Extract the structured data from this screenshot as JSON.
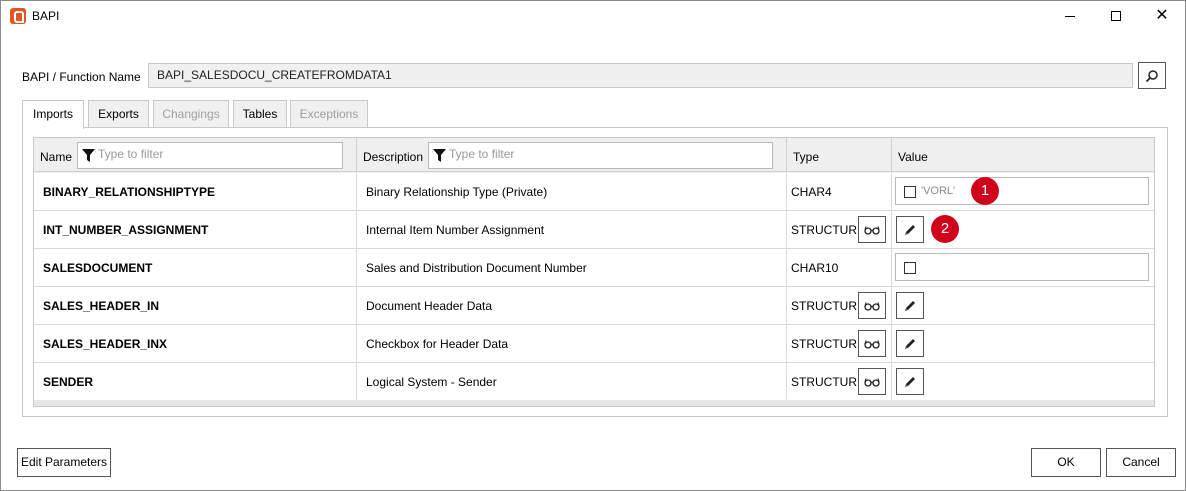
{
  "window": {
    "title": "BAPI",
    "icons": {
      "app": "app-logo-icon",
      "minimize": "minimize-icon",
      "maximize": "maximize-icon",
      "close": "close-icon"
    }
  },
  "function": {
    "label": "BAPI / Function Name",
    "value": "BAPI_SALESDOCU_CREATEFROMDATA1",
    "search_icon": "search-icon"
  },
  "tabs": [
    {
      "label": "Imports",
      "active": true,
      "enabled": true
    },
    {
      "label": "Exports",
      "active": false,
      "enabled": true
    },
    {
      "label": "Changings",
      "active": false,
      "enabled": false
    },
    {
      "label": "Tables",
      "active": false,
      "enabled": true
    },
    {
      "label": "Exceptions",
      "active": false,
      "enabled": false
    }
  ],
  "grid": {
    "columns": {
      "name": "Name",
      "description": "Description",
      "type": "Type",
      "value": "Value"
    },
    "name_filter_placeholder": "Type to filter",
    "desc_filter_placeholder": "Type to filter",
    "rows": [
      {
        "name": "BINARY_RELATIONSHIPTYPE",
        "description": "Binary Relationship Type (Private)",
        "type": "CHAR4",
        "value": "'VORL'",
        "badge": "1"
      },
      {
        "name": "INT_NUMBER_ASSIGNMENT",
        "description": "Internal Item Number Assignment",
        "type": "STRUCTURE",
        "badge": "2"
      },
      {
        "name": "SALESDOCUMENT",
        "description": "Sales and Distribution Document Number",
        "type": "CHAR10",
        "value": ""
      },
      {
        "name": "SALES_HEADER_IN",
        "description": "Document Header Data",
        "type": "STRUCTURE"
      },
      {
        "name": "SALES_HEADER_INX",
        "description": "Checkbox for Header Data",
        "type": "STRUCTURE"
      },
      {
        "name": "SENDER",
        "description": "Logical System - Sender",
        "type": "STRUCTURE"
      }
    ]
  },
  "buttons": {
    "edit_parameters": "Edit Parameters",
    "ok": "OK",
    "cancel": "Cancel"
  },
  "colors": {
    "badge": "#d0021b",
    "logo": "#e8541f"
  }
}
